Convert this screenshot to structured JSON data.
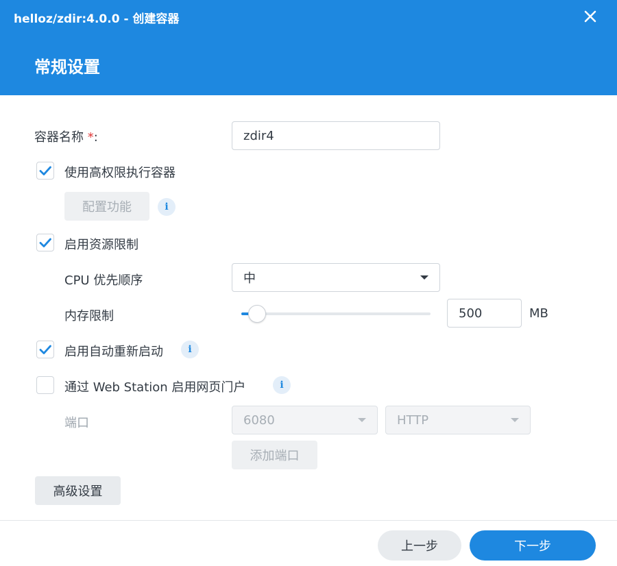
{
  "window": {
    "title": "helloz/zdir:4.0.0 - 创建容器"
  },
  "page": {
    "title": "常规设置"
  },
  "form": {
    "container_name": {
      "label": "容器名称",
      "required_mark": "*",
      "colon": ":",
      "value": "zdir4"
    },
    "privileged": {
      "label": "使用高权限执行容器",
      "checked": true,
      "config_button": "配置功能"
    },
    "resource_limit": {
      "label": "启用资源限制",
      "checked": true,
      "cpu_label": "CPU 优先顺序",
      "cpu_value": "中",
      "memory_label": "内存限制",
      "memory_value": "500",
      "memory_unit": "MB",
      "memory_slider_fraction": 0.04
    },
    "auto_restart": {
      "label": "启用自动重新启动",
      "checked": true
    },
    "web_portal": {
      "label": "通过 Web Station 启用网页门户",
      "checked": false,
      "port_label": "端口",
      "port_value": "6080",
      "protocol_value": "HTTP",
      "add_port_button": "添加端口"
    },
    "advanced_button": "高级设置"
  },
  "footer": {
    "prev_button": "上一步",
    "next_button": "下一步"
  },
  "colors": {
    "accent": "#1e88e0",
    "required": "#e03838"
  },
  "icons": {
    "close": "close-icon",
    "check": "check-icon",
    "info": "info-icon",
    "caret": "chevron-down-icon"
  }
}
